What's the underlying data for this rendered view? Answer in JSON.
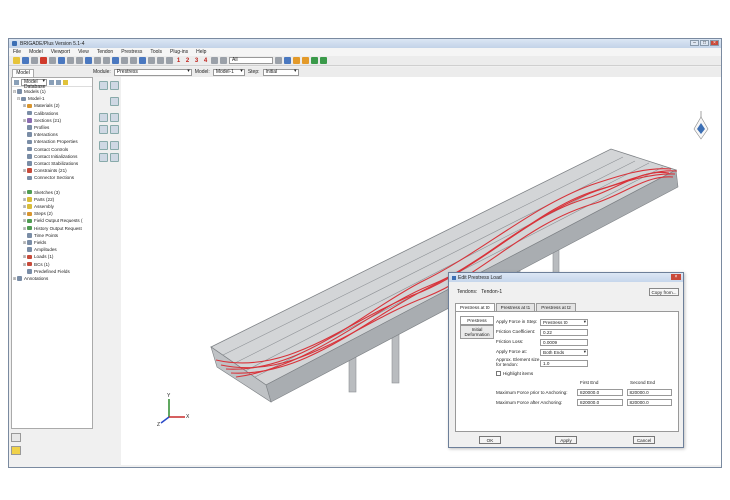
{
  "window": {
    "title": "BRIGADE/Plus Version 5.1-4"
  },
  "menu": [
    "File",
    "Model",
    "Viewport",
    "View",
    "Tendon",
    "Prestress",
    "Tools",
    "Plug-ins",
    "Help"
  ],
  "toolbar": {
    "numbers": [
      "1",
      "2",
      "3",
      "4"
    ],
    "selection_combo": "All"
  },
  "context": {
    "module_label": "Module:",
    "module_value": "Prestress",
    "model_label": "Model:",
    "model_value": "Model-1",
    "step_label": "Step:",
    "step_value": "Initial"
  },
  "tree": {
    "tab": "Model",
    "database_combo": "Model Database",
    "items": [
      {
        "label": "Models (1)",
        "exp": "⊟"
      },
      {
        "label": "Model-1",
        "exp": "⊟"
      },
      {
        "label": "Materials (2)",
        "exp": "⊞"
      },
      {
        "label": "Calibrations",
        "exp": ""
      },
      {
        "label": "Sections (21)",
        "exp": "⊞"
      },
      {
        "label": "Profiles",
        "exp": ""
      },
      {
        "label": "Interactions",
        "exp": ""
      },
      {
        "label": "Interaction Properties",
        "exp": ""
      },
      {
        "label": "Contact Controls",
        "exp": ""
      },
      {
        "label": "Contact Initializations",
        "exp": ""
      },
      {
        "label": "Contact Stabilizations",
        "exp": ""
      },
      {
        "label": "Constraints (21)",
        "exp": "⊞"
      },
      {
        "label": "Connector Sections",
        "exp": ""
      },
      {
        "label": "",
        "exp": ""
      },
      {
        "label": "Sketches (3)",
        "exp": "⊞"
      },
      {
        "label": "Parts (22)",
        "exp": "⊞"
      },
      {
        "label": "Assembly",
        "exp": "⊞"
      },
      {
        "label": "Steps (2)",
        "exp": "⊞"
      },
      {
        "label": "Field Output Requests (",
        "exp": "⊞"
      },
      {
        "label": "History Output Request",
        "exp": "⊞"
      },
      {
        "label": "Time Points",
        "exp": ""
      },
      {
        "label": "Fields",
        "exp": "⊞"
      },
      {
        "label": "Amplitudes",
        "exp": ""
      },
      {
        "label": "Loads (1)",
        "exp": "⊞"
      },
      {
        "label": "BCs (1)",
        "exp": "⊞"
      },
      {
        "label": "Predefined Fields",
        "exp": ""
      },
      {
        "label": "Annotations",
        "exp": "⊞"
      }
    ]
  },
  "triad": {
    "x": "X",
    "y": "Y",
    "z": "Z"
  },
  "dialog": {
    "title": "Edit Prestress Load",
    "tendons_label": "Tendons:",
    "tendons_value": "Tendon-1",
    "copy_button": "Copy from...",
    "tabs": [
      "Prestress at t0",
      "Prestress at t1",
      "Prestress at t2"
    ],
    "vtabs": [
      "Prestress",
      "Initial Deformation"
    ],
    "fields": {
      "apply_force_label": "Apply Force in Step:",
      "apply_force_value": "Prestress t0",
      "friction_coef_label": "Friction Coefficient:",
      "friction_coef_value": "0.22",
      "friction_loss_label": "Friction Loss:",
      "friction_loss_value": "0.0009",
      "apply_at_label": "Apply Force at:",
      "apply_at_value": "Both Ends",
      "elem_size_label": "Approx. Element size for tendon:",
      "elem_size_value": "1.0"
    },
    "highlight_label": "Highlight items",
    "table": {
      "first_end": "First End",
      "second_end": "Second End",
      "row1_label": "Maximum Force prior to Anchoring:",
      "row1_first": "820000.0",
      "row1_second": "820000.0",
      "row2_label": "Maximum Force after Anchoring:",
      "row2_first": "820000.0",
      "row2_second": "820000.0"
    },
    "buttons": {
      "ok": "OK",
      "apply": "Apply",
      "cancel": "Cancel"
    }
  },
  "colors": {
    "tendon": "#d8333a",
    "deck": "#c4c6c8",
    "accent": "#3c6fb4"
  }
}
